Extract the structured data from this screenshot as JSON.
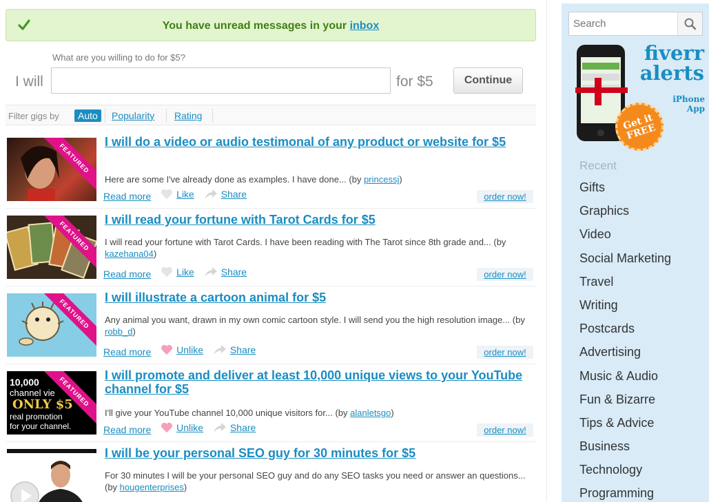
{
  "notice": {
    "text": "You have unread messages in your",
    "link": "inbox"
  },
  "form": {
    "prompt": "What are you willing to do for $5?",
    "prefix": "I will",
    "input_value": "",
    "suffix": "for $5",
    "continue_label": "Continue"
  },
  "filter": {
    "label": "Filter gigs by",
    "options": [
      "Auto",
      "Popularity",
      "Rating"
    ],
    "selected": "Auto"
  },
  "gigs": [
    {
      "title": "I will do a video or audio testimonal of any product or website for $5",
      "featured": true,
      "description": "Here are some I've already done as examples. I have done... (by ",
      "user": "princessj",
      "close": ")",
      "read_more": "Read more",
      "like_label": "Like",
      "liked": false,
      "share_label": "Share",
      "order_label": "order now!"
    },
    {
      "title": "I will read your fortune with Tarot Cards for $5",
      "featured": true,
      "description": "I will read your fortune with Tarot Cards. I have been reading with The Tarot since 8th grade and... (by ",
      "user": "kazehana04",
      "close": ")",
      "read_more": "Read more",
      "like_label": "Like",
      "liked": false,
      "share_label": "Share",
      "order_label": "order now!"
    },
    {
      "title": "I will illustrate a cartoon animal for $5",
      "featured": true,
      "description": "Any animal you want, drawn in my own comic cartoon style. I will send you the high resolution image... (by ",
      "user": "robb_d",
      "close": ")",
      "read_more": "Read more",
      "like_label": "Unlike",
      "liked": true,
      "share_label": "Share",
      "order_label": "order now!"
    },
    {
      "title": "I will promote and deliver at least 10,000 unique views to your YouTube channel for $5",
      "featured": true,
      "description": "I'll give your YouTube channel 10,000 unique visitors for... (by ",
      "user": "alanletsgo",
      "close": ")",
      "read_more": "Read more",
      "like_label": "Unlike",
      "liked": true,
      "share_label": "Share",
      "order_label": "order now!",
      "thumb_text": [
        "10,000",
        "channel vie",
        "ONLY $5",
        "real promotion",
        "for your channel."
      ]
    },
    {
      "title": "I will be your personal SEO guy for 30 minutes for $5",
      "featured": false,
      "description": "For 30 minutes I will be your personal SEO guy and do any SEO tasks you need or answer an questions... (by ",
      "user": "hougenterprises",
      "close": ")"
    }
  ],
  "ribbon_label": "FEATURED",
  "sidebar": {
    "search_placeholder": "Search",
    "promo": {
      "title_line1": "fiverr",
      "title_line2": "alerts",
      "sub_line1": "iPhone",
      "sub_line2": "App",
      "badge_line1": "Get it",
      "badge_line2": "FREE"
    },
    "recent_label": "Recent",
    "categories": [
      "Gifts",
      "Graphics",
      "Video",
      "Social Marketing",
      "Travel",
      "Writing",
      "Postcards",
      "Advertising",
      "Music & Audio",
      "Fun & Bizarre",
      "Tips & Advice",
      "Business",
      "Technology",
      "Programming"
    ]
  },
  "colors": {
    "link": "#1a8dc2",
    "notice_bg": "#e3f5cf",
    "notice_text": "#3f7f14",
    "ribbon": "#e0128a",
    "sidebar_bg": "#d8ebf7",
    "badge": "#f48a1c"
  },
  "icons": {
    "notice": "checkmark-icon",
    "like": "heart-icon",
    "share": "share-icon",
    "search": "search-icon"
  }
}
